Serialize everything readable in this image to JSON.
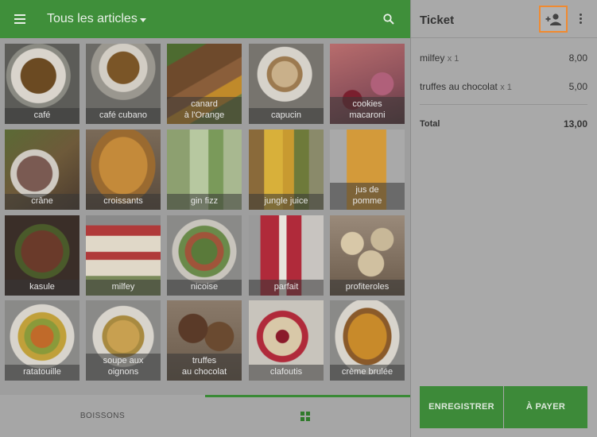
{
  "header": {
    "category_title": "Tous les articles"
  },
  "items": [
    {
      "label": "café"
    },
    {
      "label": "café cubano"
    },
    {
      "label": "canard\nà l'Orange"
    },
    {
      "label": "capucin"
    },
    {
      "label": "cookies\nmacaroni"
    },
    {
      "label": "crâne"
    },
    {
      "label": "croissants"
    },
    {
      "label": "gin fizz"
    },
    {
      "label": "jungle juice"
    },
    {
      "label": "jus de\npomme"
    },
    {
      "label": "kasule"
    },
    {
      "label": "milfey"
    },
    {
      "label": "nicoise"
    },
    {
      "label": "parfait"
    },
    {
      "label": "profiteroles"
    },
    {
      "label": "ratatouille"
    },
    {
      "label": "soupe aux\noignons"
    },
    {
      "label": "truffes\nau chocolat"
    },
    {
      "label": "clafoutis"
    },
    {
      "label": "crème brulée"
    }
  ],
  "bottom_tabs": {
    "drinks": "BOISSONS"
  },
  "ticket": {
    "title": "Ticket",
    "lines": [
      {
        "name": "milfey",
        "qty": "x 1",
        "amount": "8,00"
      },
      {
        "name": "truffes au chocolat",
        "qty": "x 1",
        "amount": "5,00"
      }
    ],
    "total_label": "Total",
    "total_amount": "13,00",
    "save_label": "ENREGISTRER",
    "pay_label": "À PAYER"
  },
  "colors": {
    "primary": "#3f8f3a",
    "highlight": "#f08a30"
  }
}
